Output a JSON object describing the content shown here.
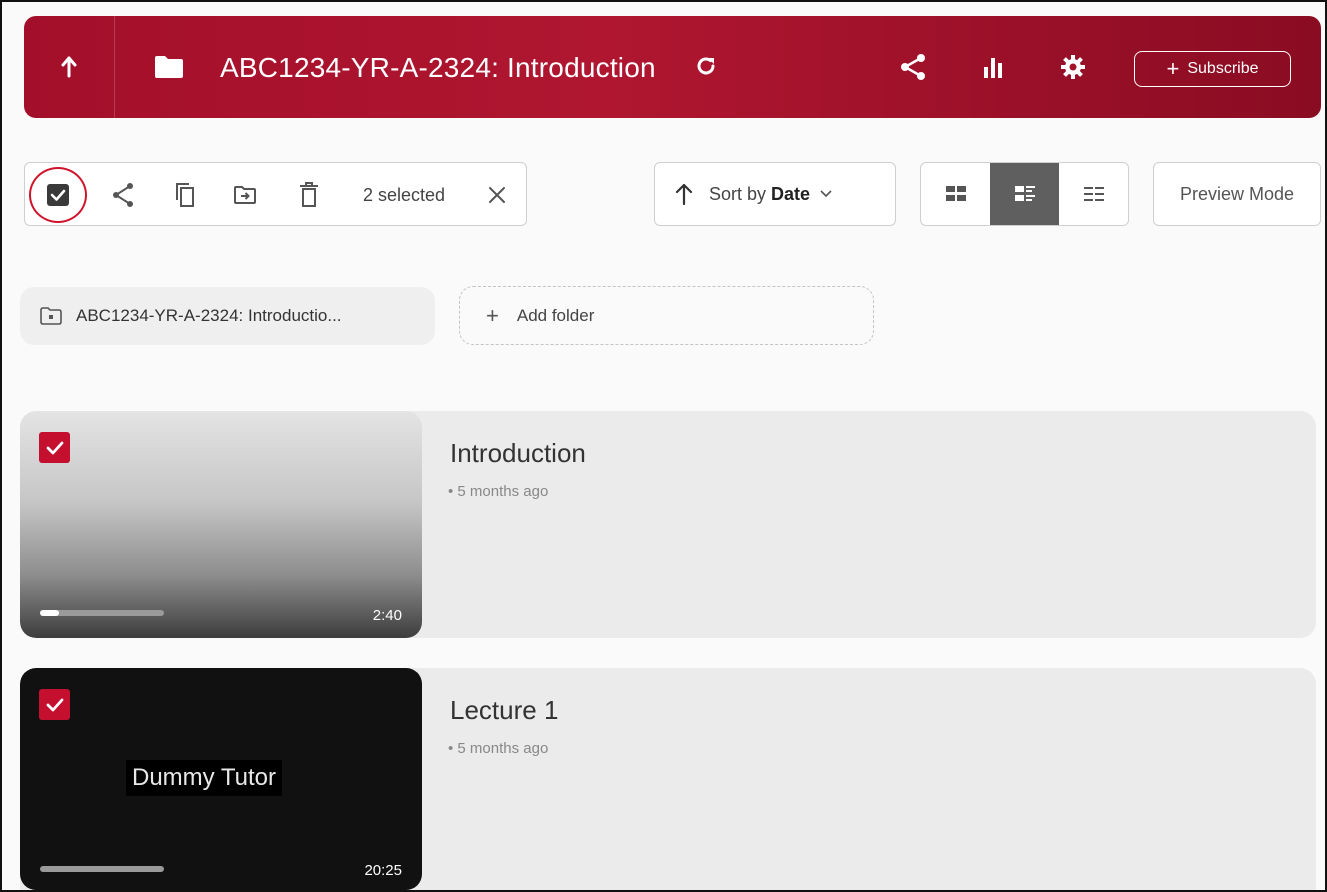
{
  "header": {
    "title": "ABC1234-YR-A-2324: Introduction",
    "subscribe_label": "Subscribe",
    "color": "#a30f2a"
  },
  "toolbar": {
    "selected_count": "2 selected",
    "sort_prefix": "Sort by",
    "sort_field": "Date",
    "preview_label": "Preview Mode",
    "active_view": "detailed-list"
  },
  "folders": {
    "current": "ABC1234-YR-A-2324: Introductio...",
    "add_label": "Add folder"
  },
  "sessions": [
    {
      "title": "Introduction",
      "meta": "5 months ago",
      "duration": "2:40",
      "checked": true,
      "progress": 0.15
    },
    {
      "title": "Lecture 1",
      "meta": "5 months ago",
      "duration": "20:25",
      "checked": true,
      "progress": 0.0,
      "thumbnail_text": "Dummy Tutor"
    }
  ],
  "colors": {
    "accent": "#c4102e",
    "annotation": "#d0142c"
  }
}
